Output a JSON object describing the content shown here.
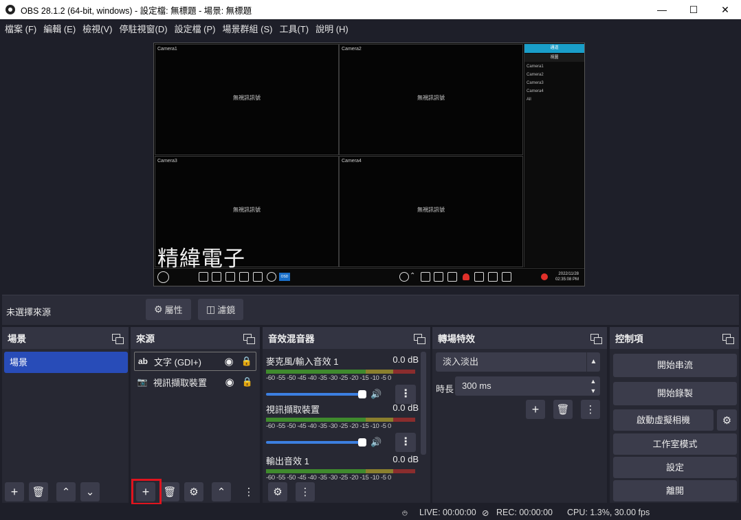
{
  "window": {
    "title": "OBS 28.1.2 (64-bit, windows) - 設定檔: 無標題 - 場景: 無標題"
  },
  "menu": [
    "檔案 (F)",
    "編輯 (E)",
    "檢視(V)",
    "停駐視窗(D)",
    "設定檔 (P)",
    "場景群組 (S)",
    "工具(T)",
    "說明 (H)"
  ],
  "preview": {
    "cameras": [
      {
        "label": "Camera1",
        "status": "無視訊訊號"
      },
      {
        "label": "Camera2",
        "status": "無視訊訊號"
      },
      {
        "label": "Camera3",
        "status": "無視訊訊號"
      },
      {
        "label": "Camera4",
        "status": "無視訊訊號"
      }
    ],
    "side_tabs": [
      "通道",
      "視圖"
    ],
    "side_list": [
      "Camera1",
      "Camera2",
      "Camera3",
      "Camera4",
      "All"
    ],
    "brand_text": "精緯電子",
    "osd_label": "OSD",
    "clock_date": "2022/11/28",
    "clock_time": "02:35:08 PM"
  },
  "source_bar": {
    "no_source": "未選擇來源",
    "properties": "屬性",
    "filters": "濾鏡"
  },
  "scenes": {
    "title": "場景",
    "items": [
      "場景"
    ]
  },
  "sources": {
    "title": "來源",
    "items": [
      {
        "type_icon": "ab",
        "name": "文字 (GDI+)"
      },
      {
        "type_icon": "camera-icon",
        "name": "視訊擷取裝置"
      }
    ]
  },
  "mixer": {
    "title": "音效混音器",
    "scale": "-60 -55 -50 -45 -40 -35 -30 -25 -20 -15 -10 -5 0",
    "channels": [
      {
        "name": "麥克風/輸入音效 1",
        "db": "0.0 dB"
      },
      {
        "name": "視訊擷取裝置",
        "db": "0.0 dB"
      },
      {
        "name": "輸出音效 1",
        "db": "0.0 dB"
      }
    ]
  },
  "transitions": {
    "title": "轉場特效",
    "selected": "淡入淡出",
    "duration_label": "時長",
    "duration_value": "300 ms"
  },
  "controls": {
    "title": "控制項",
    "buttons": [
      "開始串流",
      "開始錄製",
      "啟動虛擬相機",
      "工作室模式",
      "設定",
      "離開"
    ]
  },
  "status": {
    "live": "LIVE: 00:00:00",
    "rec": "REC: 00:00:00",
    "cpu": "CPU: 1.3%, 30.00 fps"
  },
  "colors": {
    "accent": "#284cb8",
    "highlight": "#e0141e",
    "bg": "#1e1f29",
    "dock": "#272833"
  }
}
